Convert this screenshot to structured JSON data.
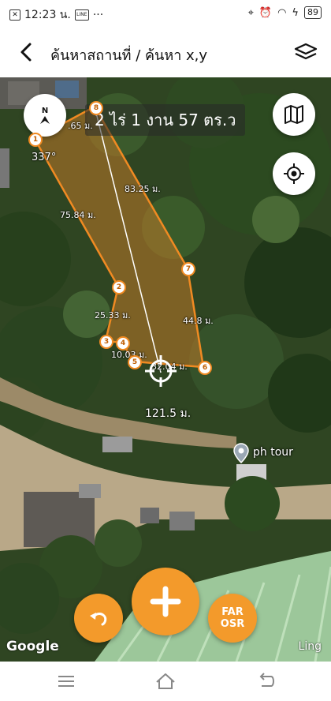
{
  "status_bar": {
    "time": "12:23 น.",
    "notification_text": "LINE",
    "more": "···",
    "battery": "89"
  },
  "app_bar": {
    "title": "ค้นหาสถานที่ / ค้นหา x,y"
  },
  "plot": {
    "area_text": "2 ไร่ 1 งาน 57 ตร.ว",
    "angle": "337°",
    "total_distance": "121.5 ม.",
    "measurements": [
      "83.25 ม.",
      "75.84 ม.",
      "25.33 ม.",
      "44.8 ม.",
      "10.03 ม.",
      "32.04 ม.",
      ".65 ม."
    ],
    "vertex_labels": [
      "1",
      "2",
      "3",
      "4",
      "5",
      "6",
      "7",
      "8"
    ]
  },
  "compass": {
    "label": "N"
  },
  "place": {
    "name": "ph tour"
  },
  "buttons": {
    "far_osr_line1": "FAR",
    "far_osr_line2": "OSR"
  },
  "map_attribution": {
    "google": "Google",
    "ling": "Ling"
  },
  "colors": {
    "accent_orange": "#f39a2b",
    "polygon_stroke": "#f08a22"
  }
}
